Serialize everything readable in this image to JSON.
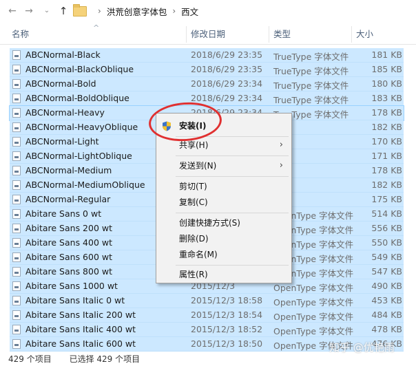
{
  "nav": {
    "back_glyph": "←",
    "forward_glyph": "→",
    "dropdown_glyph": "⌄",
    "up_glyph": "↑"
  },
  "breadcrumb": {
    "separator": "›",
    "items": [
      "洪荒创意字体包",
      "西文"
    ]
  },
  "columns": {
    "sort_glyph": "^",
    "name": "名称",
    "date": "修改日期",
    "type": "类型",
    "size": "大小"
  },
  "files": [
    {
      "name": "ABCNormal-Black",
      "date": "2018/6/29 23:35",
      "type": "TrueType 字体文件",
      "size": "181 KB"
    },
    {
      "name": "ABCNormal-BlackOblique",
      "date": "2018/6/29 23:35",
      "type": "TrueType 字体文件",
      "size": "185 KB"
    },
    {
      "name": "ABCNormal-Bold",
      "date": "2018/6/29 23:34",
      "type": "TrueType 字体文件",
      "size": "180 KB"
    },
    {
      "name": "ABCNormal-BoldOblique",
      "date": "2018/6/29 23:34",
      "type": "TrueType 字体文件",
      "size": "183 KB"
    },
    {
      "name": "ABCNormal-Heavy",
      "date": "2018/6/29 23:34",
      "type": "TrueType 字体文件",
      "size": "178 KB"
    },
    {
      "name": "ABCNormal-HeavyOblique",
      "date": "",
      "type": "",
      "size": "182 KB"
    },
    {
      "name": "ABCNormal-Light",
      "date": "",
      "type": "",
      "size": "170 KB"
    },
    {
      "name": "ABCNormal-LightOblique",
      "date": "",
      "type": "",
      "size": "171 KB"
    },
    {
      "name": "ABCNormal-Medium",
      "date": "",
      "type": "",
      "size": "178 KB"
    },
    {
      "name": "ABCNormal-MediumOblique",
      "date": "",
      "type": "",
      "size": "182 KB"
    },
    {
      "name": "ABCNormal-Regular",
      "date": "",
      "type": "",
      "size": "175 KB"
    },
    {
      "name": "Abitare Sans 0 wt",
      "date": "",
      "type": "OpenType 字体文件",
      "size": "514 KB"
    },
    {
      "name": "Abitare Sans 200 wt",
      "date": "",
      "type": "OpenType 字体文件",
      "size": "556 KB"
    },
    {
      "name": "Abitare Sans 400 wt",
      "date": "",
      "type": "OpenType 字体文件",
      "size": "550 KB"
    },
    {
      "name": "Abitare Sans 600 wt",
      "date": "",
      "type": "OpenType 字体文件",
      "size": "549 KB"
    },
    {
      "name": "Abitare Sans 800 wt",
      "date": "",
      "type": "OpenType 字体文件",
      "size": "547 KB"
    },
    {
      "name": "Abitare Sans 1000 wt",
      "date": "2015/12/3",
      "type": "OpenType 字体文件",
      "size": "490 KB"
    },
    {
      "name": "Abitare Sans Italic 0 wt",
      "date": "2015/12/3 18:58",
      "type": "OpenType 字体文件",
      "size": "453 KB"
    },
    {
      "name": "Abitare Sans Italic 200 wt",
      "date": "2015/12/3 18:54",
      "type": "OpenType 字体文件",
      "size": "484 KB"
    },
    {
      "name": "Abitare Sans Italic 400 wt",
      "date": "2015/12/3 18:52",
      "type": "OpenType 字体文件",
      "size": "478 KB"
    },
    {
      "name": "Abitare Sans Italic 600 wt",
      "date": "2015/12/3 18:50",
      "type": "OpenType 字体文件",
      "size": "476 KB"
    }
  ],
  "context_menu": {
    "install": "安装(I)",
    "share": "共享(H)",
    "send_to": "发送到(N)",
    "cut": "剪切(T)",
    "copy": "复制(C)",
    "create_shortcut": "创建快捷方式(S)",
    "delete": "删除(D)",
    "rename": "重命名(M)",
    "properties": "属性(R)",
    "submenu_arrow": "›"
  },
  "status": {
    "item_count": "429 个项目",
    "selected_count": "已选择 429 个项目"
  },
  "watermark": "知乎 @优艳雨",
  "colors": {
    "selection": "#cce8ff",
    "header_text": "#4c607a",
    "annotation": "#e03030"
  }
}
